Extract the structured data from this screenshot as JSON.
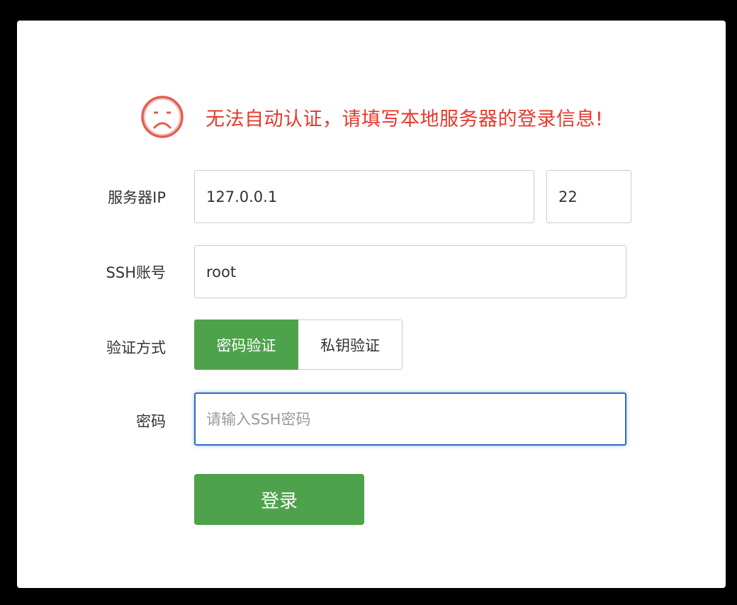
{
  "warning": {
    "icon": "sad-face-icon",
    "message": "无法自动认证，请填写本地服务器的登录信息!",
    "color": "#e8372a"
  },
  "form": {
    "server_ip": {
      "label": "服务器IP",
      "value": "127.0.0.1"
    },
    "port": {
      "value": "22"
    },
    "ssh_account": {
      "label": "SSH账号",
      "value": "root"
    },
    "auth_method": {
      "label": "验证方式",
      "options": [
        "密码验证",
        "私钥验证"
      ],
      "selected": "密码验证"
    },
    "password": {
      "label": "密码",
      "value": "",
      "placeholder": "请输入SSH密码"
    },
    "submit_label": "登录"
  },
  "colors": {
    "accent": "#4fa24c",
    "focus_border": "#2f6bc8",
    "error_text": "#e8372a"
  }
}
